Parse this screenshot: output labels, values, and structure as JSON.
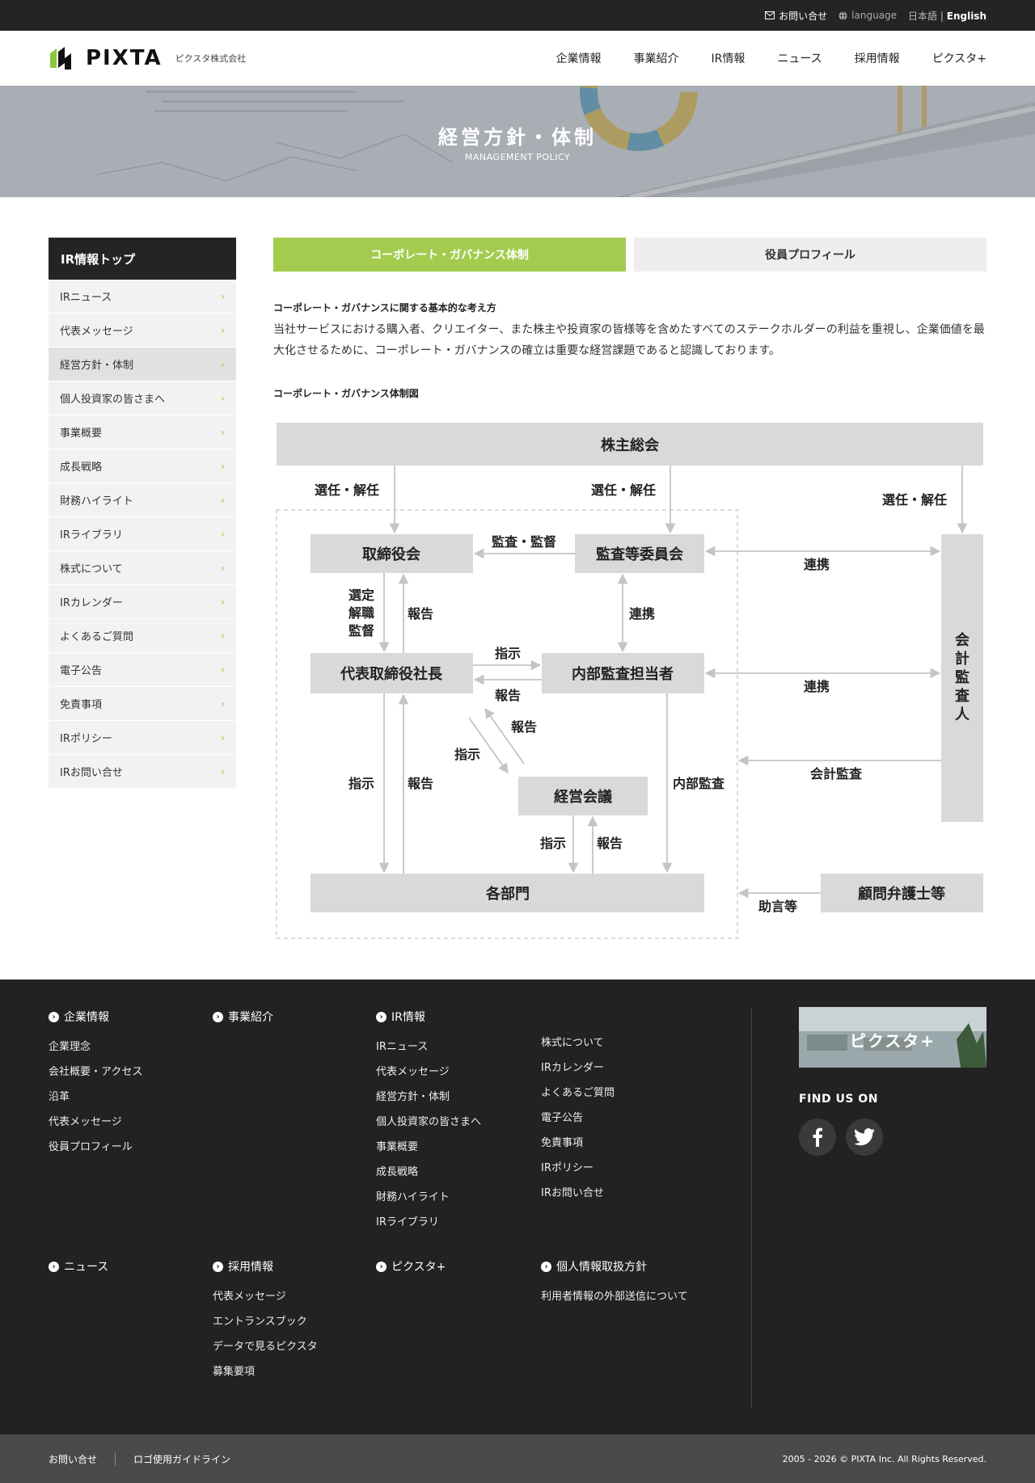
{
  "topbar": {
    "contact": "お問い合せ",
    "language_label": "language",
    "lang_ja": "日本語",
    "lang_separator": "|",
    "lang_en": "English"
  },
  "header": {
    "logo_word": "PIXTA",
    "corp_name": "ピクスタ株式会社",
    "nav": [
      "企業情報",
      "事業紹介",
      "IR情報",
      "ニュース",
      "採用情報",
      "ピクスタ+"
    ]
  },
  "hero": {
    "title": "経営方針・体制",
    "subtitle": "MANAGEMENT POLICY"
  },
  "sidebar": {
    "top": "IR情報トップ",
    "items": [
      "IRニュース",
      "代表メッセージ",
      "経営方針・体制",
      "個人投資家の皆さまへ",
      "事業概要",
      "成長戦略",
      "財務ハイライト",
      "IRライブラリ",
      "株式について",
      "IRカレンダー",
      "よくあるご質問",
      "電子公告",
      "免責事項",
      "IRポリシー",
      "IRお問い合せ"
    ],
    "active_index": 2,
    "chevron": "›"
  },
  "tabs": {
    "active": "コーポレート・ガバナンス体制",
    "inactive": "役員プロフィール"
  },
  "content": {
    "heading": "コーポレート・ガバナンスに関する基本的な考え方",
    "body": "当社サービスにおける購入者、クリエイター、また株主や投資家の皆様等を含めたすべてのステークホルダーの利益を重視し、企業価値を最大化させるために、コーポレート・ガバナンスの確立は重要な経営課題であると認識しております。",
    "diagram_heading": "コーポレート・ガバナンス体制図"
  },
  "diagram": {
    "nodes": {
      "shareholders": "株主総会",
      "board": "取締役会",
      "audit_committee": "監査等委員会",
      "ceo": "代表取締役社長",
      "internal_audit": "内部監査担当者",
      "management_meeting": "経営会議",
      "departments": "各部門",
      "accounting_auditor": "会計監査人",
      "legal_advisor": "顧問弁護士等"
    },
    "labels": {
      "elect_dismiss": "選任・解任",
      "audit_supervise": "監査・監督",
      "cooperation": "連携",
      "select": "選定",
      "dismiss": "解職",
      "supervise": "監督",
      "report": "報告",
      "instruct": "指示",
      "internal_audit_label": "内部監査",
      "accounting_audit": "会計監査",
      "advice": "助言等"
    }
  },
  "footer": {
    "corp_head": "企業情報",
    "corp_links": [
      "企業理念",
      "会社概要・アクセス",
      "沿革",
      "代表メッセージ",
      "役員プロフィール"
    ],
    "biz_head": "事業紹介",
    "ir_head": "IR情報",
    "ir_links_1": [
      "IRニュース",
      "代表メッセージ",
      "経営方針・体制",
      "個人投資家の皆さまへ",
      "事業概要",
      "成長戦略",
      "財務ハイライト",
      "IRライブラリ"
    ],
    "ir_links_2": [
      "株式について",
      "IRカレンダー",
      "よくあるご質問",
      "電子公告",
      "免責事項",
      "IRポリシー",
      "IRお問い合せ"
    ],
    "news_head": "ニュース",
    "recruit_head": "採用情報",
    "recruit_links": [
      "代表メッセージ",
      "エントランスブック",
      "データで見るピクスタ",
      "募集要項"
    ],
    "pixtaplus_head": "ピクスタ+",
    "privacy_head": "個人情報取扱方針",
    "privacy_links": [
      "利用者情報の外部送信について"
    ],
    "banner": "ピクスタ+",
    "find_us": "FIND US ON"
  },
  "bottombar": {
    "links": [
      "お問い合せ",
      "ロゴ使用ガイドライン"
    ],
    "copyright": "2005 - 2026 © PIXTA Inc. All Rights Reserved."
  },
  "colors": {
    "accent_green": "#a3cc4f",
    "dark": "#242424",
    "box_gray": "#d9d9d9",
    "arrow_gray": "#c8c8c8"
  }
}
